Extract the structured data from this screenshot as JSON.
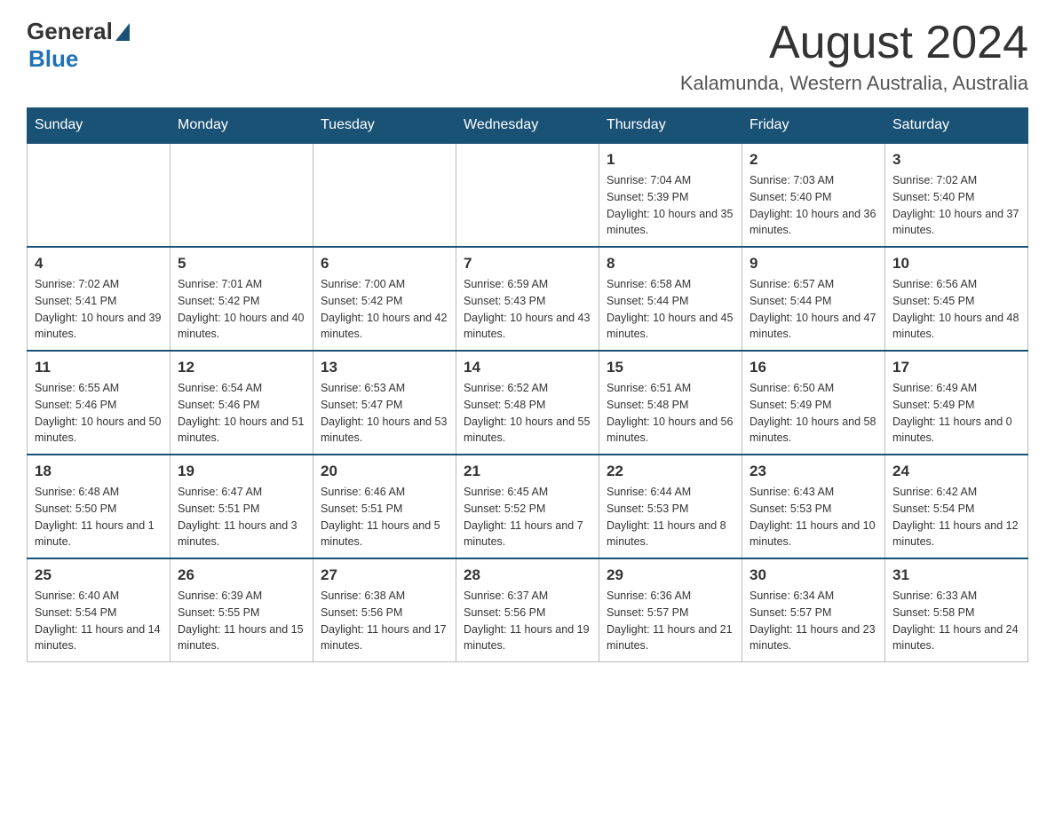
{
  "header": {
    "logo_general": "General",
    "logo_blue": "Blue",
    "month_title": "August 2024",
    "location": "Kalamunda, Western Australia, Australia"
  },
  "days_of_week": [
    "Sunday",
    "Monday",
    "Tuesday",
    "Wednesday",
    "Thursday",
    "Friday",
    "Saturday"
  ],
  "weeks": [
    [
      {
        "day": "",
        "info": ""
      },
      {
        "day": "",
        "info": ""
      },
      {
        "day": "",
        "info": ""
      },
      {
        "day": "",
        "info": ""
      },
      {
        "day": "1",
        "info": "Sunrise: 7:04 AM\nSunset: 5:39 PM\nDaylight: 10 hours and 35 minutes."
      },
      {
        "day": "2",
        "info": "Sunrise: 7:03 AM\nSunset: 5:40 PM\nDaylight: 10 hours and 36 minutes."
      },
      {
        "day": "3",
        "info": "Sunrise: 7:02 AM\nSunset: 5:40 PM\nDaylight: 10 hours and 37 minutes."
      }
    ],
    [
      {
        "day": "4",
        "info": "Sunrise: 7:02 AM\nSunset: 5:41 PM\nDaylight: 10 hours and 39 minutes."
      },
      {
        "day": "5",
        "info": "Sunrise: 7:01 AM\nSunset: 5:42 PM\nDaylight: 10 hours and 40 minutes."
      },
      {
        "day": "6",
        "info": "Sunrise: 7:00 AM\nSunset: 5:42 PM\nDaylight: 10 hours and 42 minutes."
      },
      {
        "day": "7",
        "info": "Sunrise: 6:59 AM\nSunset: 5:43 PM\nDaylight: 10 hours and 43 minutes."
      },
      {
        "day": "8",
        "info": "Sunrise: 6:58 AM\nSunset: 5:44 PM\nDaylight: 10 hours and 45 minutes."
      },
      {
        "day": "9",
        "info": "Sunrise: 6:57 AM\nSunset: 5:44 PM\nDaylight: 10 hours and 47 minutes."
      },
      {
        "day": "10",
        "info": "Sunrise: 6:56 AM\nSunset: 5:45 PM\nDaylight: 10 hours and 48 minutes."
      }
    ],
    [
      {
        "day": "11",
        "info": "Sunrise: 6:55 AM\nSunset: 5:46 PM\nDaylight: 10 hours and 50 minutes."
      },
      {
        "day": "12",
        "info": "Sunrise: 6:54 AM\nSunset: 5:46 PM\nDaylight: 10 hours and 51 minutes."
      },
      {
        "day": "13",
        "info": "Sunrise: 6:53 AM\nSunset: 5:47 PM\nDaylight: 10 hours and 53 minutes."
      },
      {
        "day": "14",
        "info": "Sunrise: 6:52 AM\nSunset: 5:48 PM\nDaylight: 10 hours and 55 minutes."
      },
      {
        "day": "15",
        "info": "Sunrise: 6:51 AM\nSunset: 5:48 PM\nDaylight: 10 hours and 56 minutes."
      },
      {
        "day": "16",
        "info": "Sunrise: 6:50 AM\nSunset: 5:49 PM\nDaylight: 10 hours and 58 minutes."
      },
      {
        "day": "17",
        "info": "Sunrise: 6:49 AM\nSunset: 5:49 PM\nDaylight: 11 hours and 0 minutes."
      }
    ],
    [
      {
        "day": "18",
        "info": "Sunrise: 6:48 AM\nSunset: 5:50 PM\nDaylight: 11 hours and 1 minute."
      },
      {
        "day": "19",
        "info": "Sunrise: 6:47 AM\nSunset: 5:51 PM\nDaylight: 11 hours and 3 minutes."
      },
      {
        "day": "20",
        "info": "Sunrise: 6:46 AM\nSunset: 5:51 PM\nDaylight: 11 hours and 5 minutes."
      },
      {
        "day": "21",
        "info": "Sunrise: 6:45 AM\nSunset: 5:52 PM\nDaylight: 11 hours and 7 minutes."
      },
      {
        "day": "22",
        "info": "Sunrise: 6:44 AM\nSunset: 5:53 PM\nDaylight: 11 hours and 8 minutes."
      },
      {
        "day": "23",
        "info": "Sunrise: 6:43 AM\nSunset: 5:53 PM\nDaylight: 11 hours and 10 minutes."
      },
      {
        "day": "24",
        "info": "Sunrise: 6:42 AM\nSunset: 5:54 PM\nDaylight: 11 hours and 12 minutes."
      }
    ],
    [
      {
        "day": "25",
        "info": "Sunrise: 6:40 AM\nSunset: 5:54 PM\nDaylight: 11 hours and 14 minutes."
      },
      {
        "day": "26",
        "info": "Sunrise: 6:39 AM\nSunset: 5:55 PM\nDaylight: 11 hours and 15 minutes."
      },
      {
        "day": "27",
        "info": "Sunrise: 6:38 AM\nSunset: 5:56 PM\nDaylight: 11 hours and 17 minutes."
      },
      {
        "day": "28",
        "info": "Sunrise: 6:37 AM\nSunset: 5:56 PM\nDaylight: 11 hours and 19 minutes."
      },
      {
        "day": "29",
        "info": "Sunrise: 6:36 AM\nSunset: 5:57 PM\nDaylight: 11 hours and 21 minutes."
      },
      {
        "day": "30",
        "info": "Sunrise: 6:34 AM\nSunset: 5:57 PM\nDaylight: 11 hours and 23 minutes."
      },
      {
        "day": "31",
        "info": "Sunrise: 6:33 AM\nSunset: 5:58 PM\nDaylight: 11 hours and 24 minutes."
      }
    ]
  ]
}
